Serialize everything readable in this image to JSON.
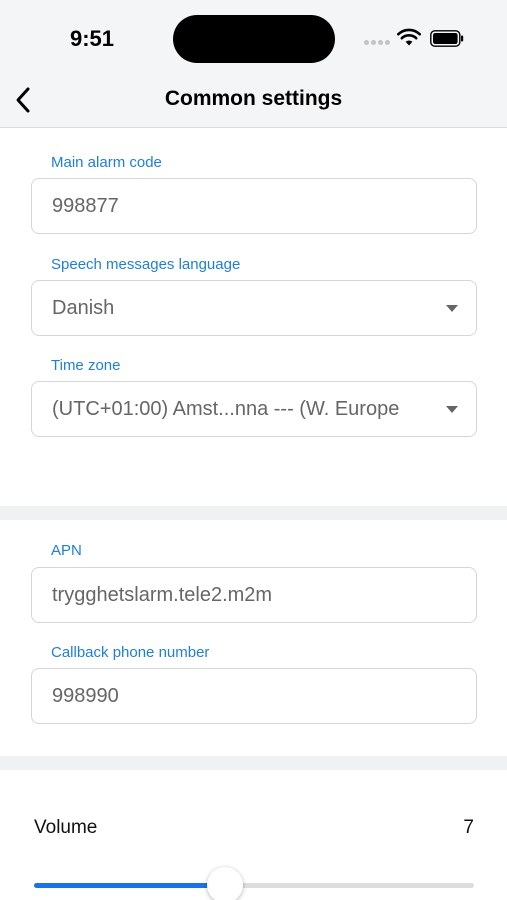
{
  "status_bar": {
    "time": "9:51"
  },
  "nav": {
    "title": "Common settings",
    "back_icon": "chevron-left-icon"
  },
  "fields": {
    "main_alarm_code": {
      "label": "Main alarm code",
      "value": "998877"
    },
    "speech_language": {
      "label": "Speech messages language",
      "value": "Danish"
    },
    "time_zone": {
      "label": "Time zone",
      "value": "(UTC+01:00) Amst...nna --- (W. Europe"
    },
    "apn": {
      "label": "APN",
      "value": "trygghetslarm.tele2.m2m"
    },
    "callback_phone": {
      "label": "Callback phone number",
      "value": "998990"
    }
  },
  "volume": {
    "label": "Volume",
    "value": "7",
    "level": 0.433
  },
  "colors": {
    "accent": "#1f7fd4",
    "slider_active": "#1a73e8",
    "background": "#f4f5f7"
  }
}
